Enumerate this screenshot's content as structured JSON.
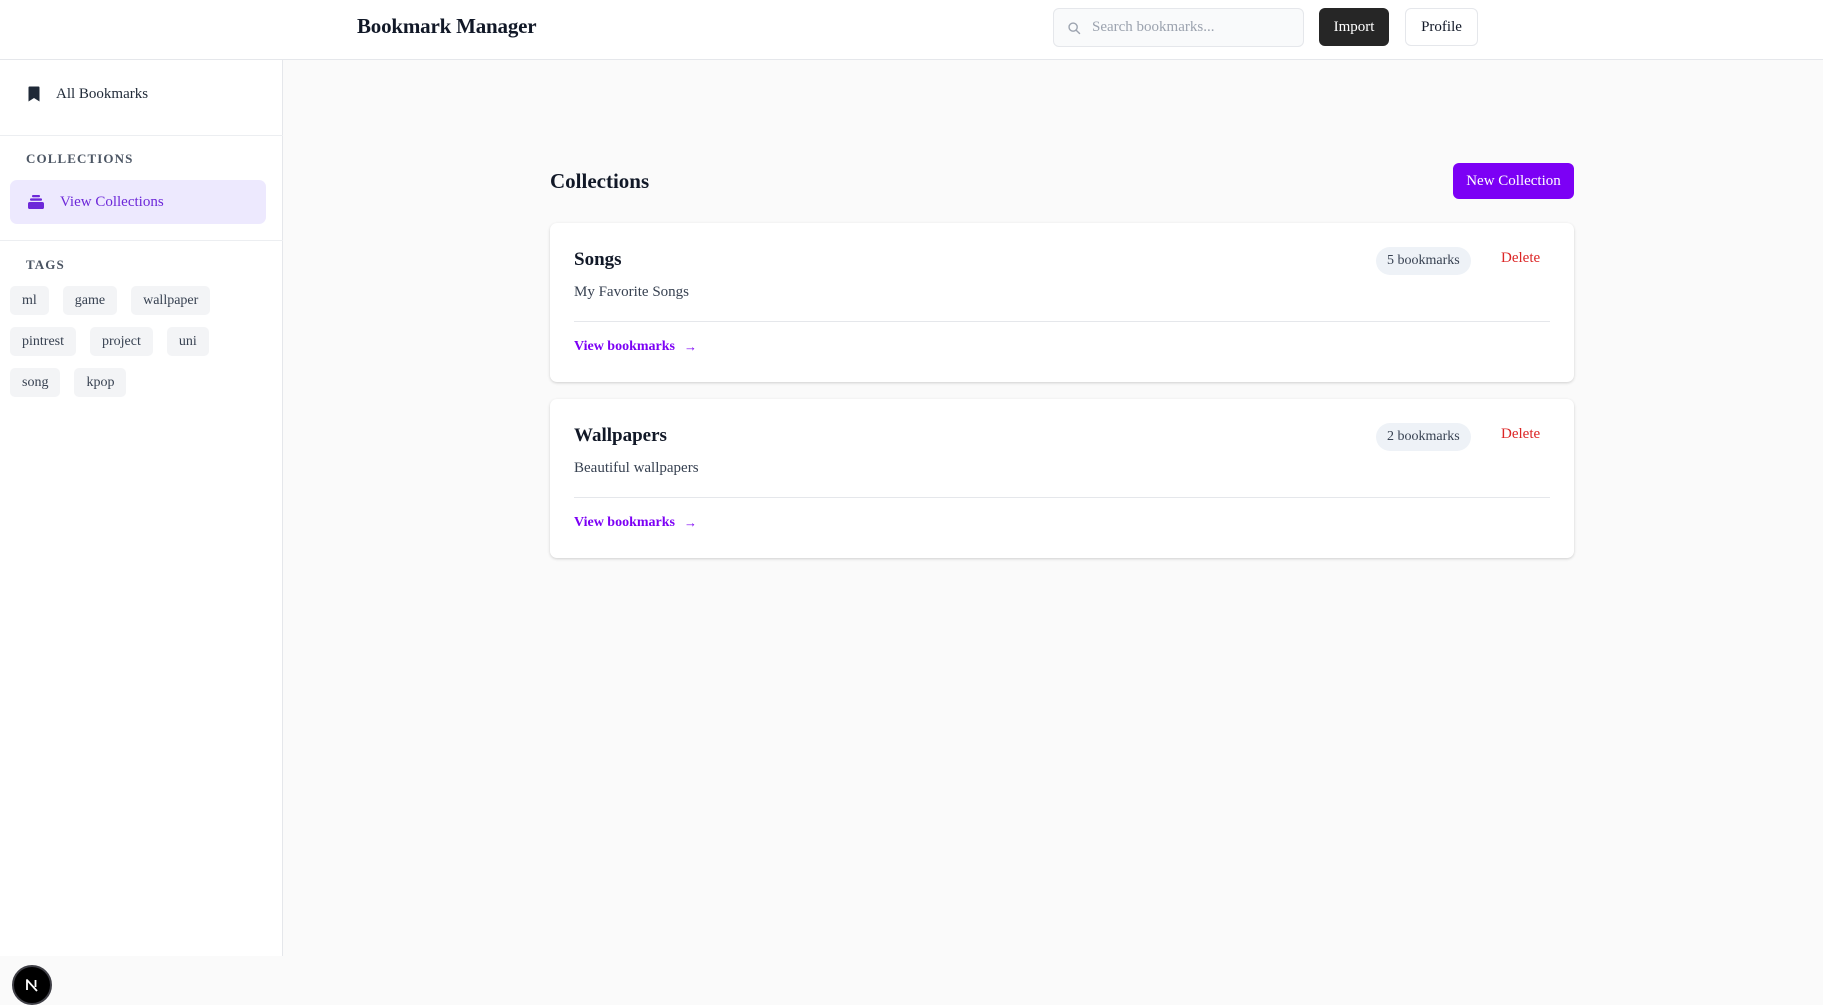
{
  "header": {
    "title": "Bookmark Manager",
    "search_placeholder": "Search bookmarks...",
    "import_label": "Import",
    "profile_label": "Profile"
  },
  "sidebar": {
    "all_bookmarks_label": "All Bookmarks",
    "collections_heading": "COLLECTIONS",
    "view_collections_label": "View Collections",
    "tags_heading": "TAGS",
    "tags": [
      "ml",
      "game",
      "wallpaper",
      "pintrest",
      "project",
      "uni",
      "song",
      "kpop"
    ],
    "active_item": "View Collections"
  },
  "main": {
    "page_title": "Collections",
    "new_collection_label": "New Collection",
    "collections": [
      {
        "name": "Songs",
        "description": "My Favorite Songs",
        "count_label": "5 bookmarks",
        "delete_label": "Delete",
        "view_label": "View bookmarks",
        "arrow": "→"
      },
      {
        "name": "Wallpapers",
        "description": "Beautiful wallpapers",
        "count_label": "2 bookmarks",
        "delete_label": "Delete",
        "view_label": "View bookmarks",
        "arrow": "→"
      }
    ]
  },
  "colors": {
    "accent": "#7c00f5",
    "accent_soft": "#ede9fe",
    "danger": "#dc2626",
    "import_button": "#262626"
  },
  "icons": {
    "search": "search-icon",
    "all_bookmarks": "bookmark-icon",
    "collections": "stack-icon",
    "badge": "nextjs-logo-icon"
  }
}
